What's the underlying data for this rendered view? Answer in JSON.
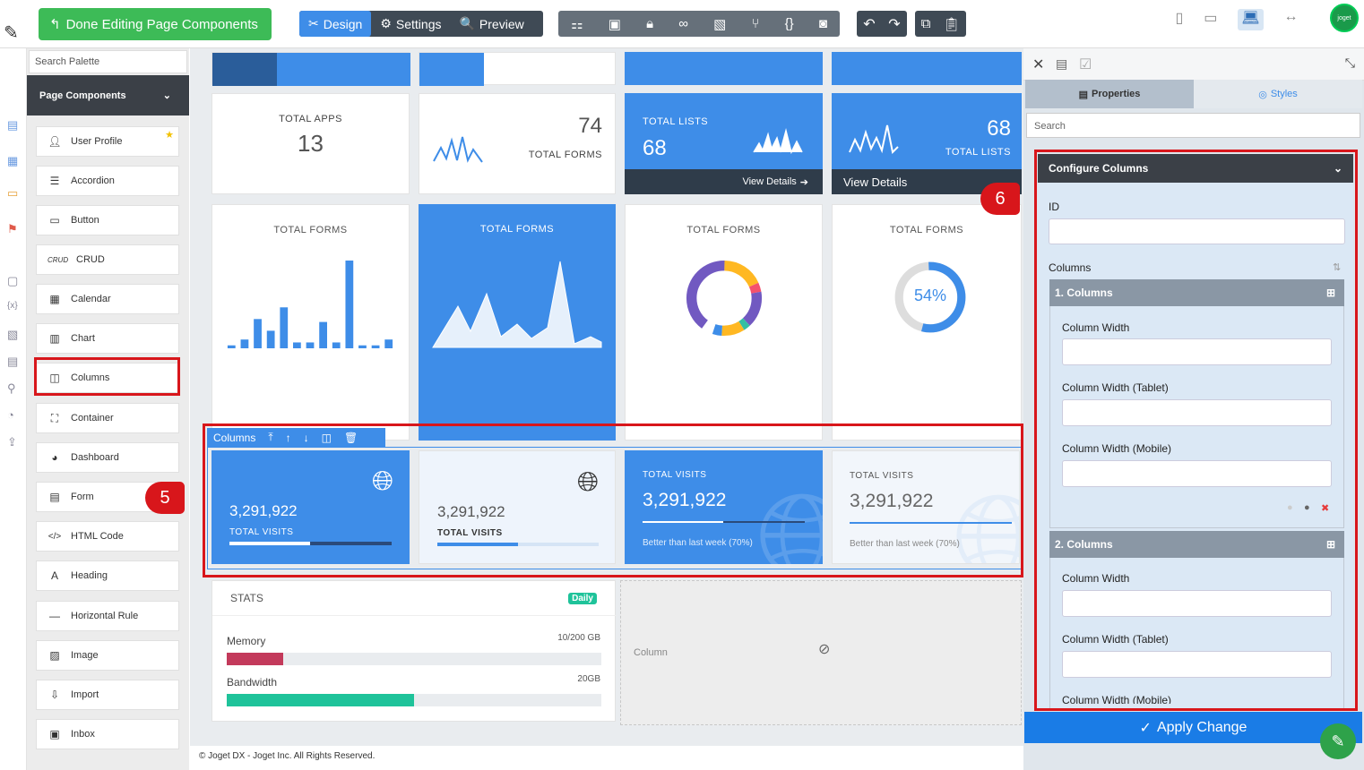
{
  "topbar": {
    "done_label": "Done Editing Page Components",
    "modes": [
      "Design",
      "Settings",
      "Preview"
    ],
    "tool_icons": [
      "tree-icon",
      "layout-icon",
      "lock-icon",
      "binoculars-icon",
      "translate-icon",
      "branch-icon",
      "code-icon",
      "camera-icon"
    ],
    "logo_text": "joget"
  },
  "palette": {
    "search_placeholder": "Search Palette",
    "header": "Page Components",
    "items": [
      "User Profile",
      "Accordion",
      "Button",
      "CRUD",
      "Calendar",
      "Chart",
      "Columns",
      "Container",
      "Dashboard",
      "Form",
      "HTML Code",
      "Heading",
      "Horizontal Rule",
      "Image",
      "Import",
      "Inbox"
    ],
    "crud_prefix": "CRUD"
  },
  "canvas": {
    "row1": {
      "total_apps_label": "TOTAL APPS",
      "total_apps_value": "13",
      "total_forms_value": "74",
      "total_forms_label": "TOTAL FORMS",
      "total_lists_label": "TOTAL LISTS",
      "total_lists_value": "68",
      "view_details": "View Details",
      "total_lists_value2": "68",
      "total_lists_label2": "TOTAL LISTS",
      "view_details2": "View Details"
    },
    "row2": {
      "label1": "TOTAL FORMS",
      "label2": "TOTAL FORMS",
      "label3": "TOTAL FORMS",
      "label4": "TOTAL FORMS",
      "gauge_value": "54%"
    },
    "columns_toolbar": {
      "label": "Columns"
    },
    "row3": {
      "v1": "3,291,922",
      "l1": "TOTAL VISITS",
      "v2": "3,291,922",
      "l2": "TOTAL VISITS",
      "l3": "TOTAL VISITS",
      "v3": "3,291,922",
      "s3": "Better than last week (70%)",
      "l4": "TOTAL VISITS",
      "v4": "3,291,922",
      "s4": "Better than last week (70%)"
    },
    "stats": {
      "title": "STATS",
      "badge": "Daily",
      "memory_label": "Memory",
      "memory_value": "10/200 GB",
      "memory_fill": 0.15,
      "bandwidth_label": "Bandwidth",
      "bandwidth_value": "20GB",
      "bandwidth_fill": 0.5
    },
    "empty_column_label": "Column",
    "footer": "© Joget DX - Joget Inc. All Rights Reserved."
  },
  "bar_chart": {
    "values": [
      1,
      3,
      10,
      6,
      14,
      2,
      2,
      9,
      2,
      30,
      1,
      1,
      3
    ],
    "ylim": [
      0,
      30
    ]
  },
  "right_panel": {
    "tabs": [
      "Properties",
      "Styles"
    ],
    "search_placeholder": "Search",
    "section_title": "Configure Columns",
    "id_label": "ID",
    "columns_label": "Columns",
    "col1_title": "1. Columns",
    "col2_title": "2. Columns",
    "width_label": "Column Width",
    "width_tablet_label": "Column Width (Tablet)",
    "width_mobile_label": "Column Width (Mobile)",
    "apply_label": "Apply Change"
  },
  "annotations": {
    "badge5": "5",
    "badge6": "6"
  }
}
